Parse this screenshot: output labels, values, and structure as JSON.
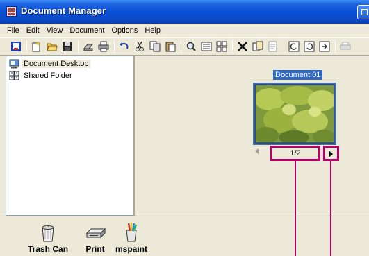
{
  "window": {
    "title": "Document Manager"
  },
  "menu": [
    "File",
    "Edit",
    "View",
    "Document",
    "Options",
    "Help"
  ],
  "toolbar": {
    "icons": [
      "new-blue-icon",
      "new-folder-icon",
      "open-icon",
      "save-icon",
      "scan-icon",
      "print-icon",
      "undo-icon",
      "cut-icon",
      "copy-icon",
      "paste-icon",
      "zoom-icon",
      "details-icon",
      "thumbnails-icon",
      "delete-icon",
      "duplicate-icon",
      "properties-icon",
      "rotate-left-icon",
      "rotate-right-icon",
      "next-page-icon",
      "printer-icon"
    ]
  },
  "tree": {
    "items": [
      {
        "label": "Document Desktop",
        "icon": "desktop-icon"
      },
      {
        "label": "Shared Folder",
        "icon": "shared-folder-icon"
      }
    ]
  },
  "document": {
    "title": "Document 01",
    "page_indicator": "1/2"
  },
  "tray": {
    "items": [
      {
        "label": "Trash Can",
        "icon": "trash-can-icon"
      },
      {
        "label": "Print",
        "icon": "printer-icon"
      },
      {
        "label": "mspaint",
        "icon": "mspaint-icon"
      }
    ]
  },
  "colors": {
    "titlebar": "#0a4fd6",
    "callout": "#b5006a",
    "selection": "#316ac5"
  }
}
